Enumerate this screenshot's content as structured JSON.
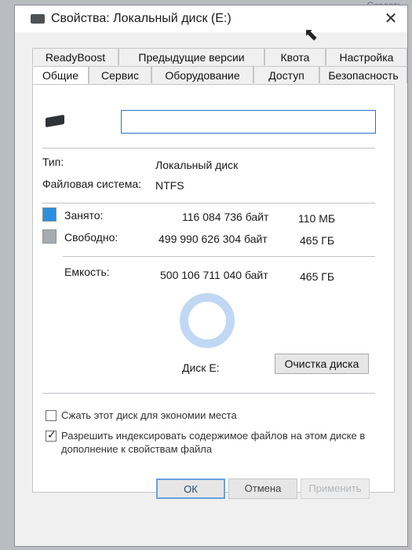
{
  "background": {
    "hint_text": "Создать"
  },
  "window": {
    "title": "Свойства: Локальный диск (E:)"
  },
  "tabs": {
    "row1": [
      {
        "label": "ReadyBoost"
      },
      {
        "label": "Предыдущие версии"
      },
      {
        "label": "Квота"
      },
      {
        "label": "Настройка"
      }
    ],
    "row2": [
      {
        "label": "Общие",
        "active": true
      },
      {
        "label": "Сервис"
      },
      {
        "label": "Оборудование"
      },
      {
        "label": "Доступ"
      },
      {
        "label": "Безопасность"
      }
    ]
  },
  "general": {
    "name_input": {
      "value": ""
    },
    "type_label": "Тип:",
    "type_value": "Локальный диск",
    "fs_label": "Файловая система:",
    "fs_value": "NTFS",
    "used": {
      "label": "Занято:",
      "bytes": "116 084 736 байт",
      "size": "110 МБ",
      "color": "#2b8fe0"
    },
    "free": {
      "label": "Свободно:",
      "bytes": "499 990 626 304 байт",
      "size": "465 ГБ",
      "color": "#a6abb0"
    },
    "capacity": {
      "label": "Емкость:",
      "bytes": "500 106 711 040 байт",
      "size": "465 ГБ"
    },
    "disk_label": "Диск E:",
    "cleanup_button": "Очистка диска",
    "compress_checkbox": {
      "label": "Сжать этот диск для экономии места",
      "checked": false
    },
    "index_checkbox": {
      "label": "Разрешить индексировать содержимое файлов на этом диске в дополнение к свойствам файла",
      "checked": true
    }
  },
  "footer": {
    "ok": "ОК",
    "cancel": "Отмена",
    "apply": "Применить"
  }
}
